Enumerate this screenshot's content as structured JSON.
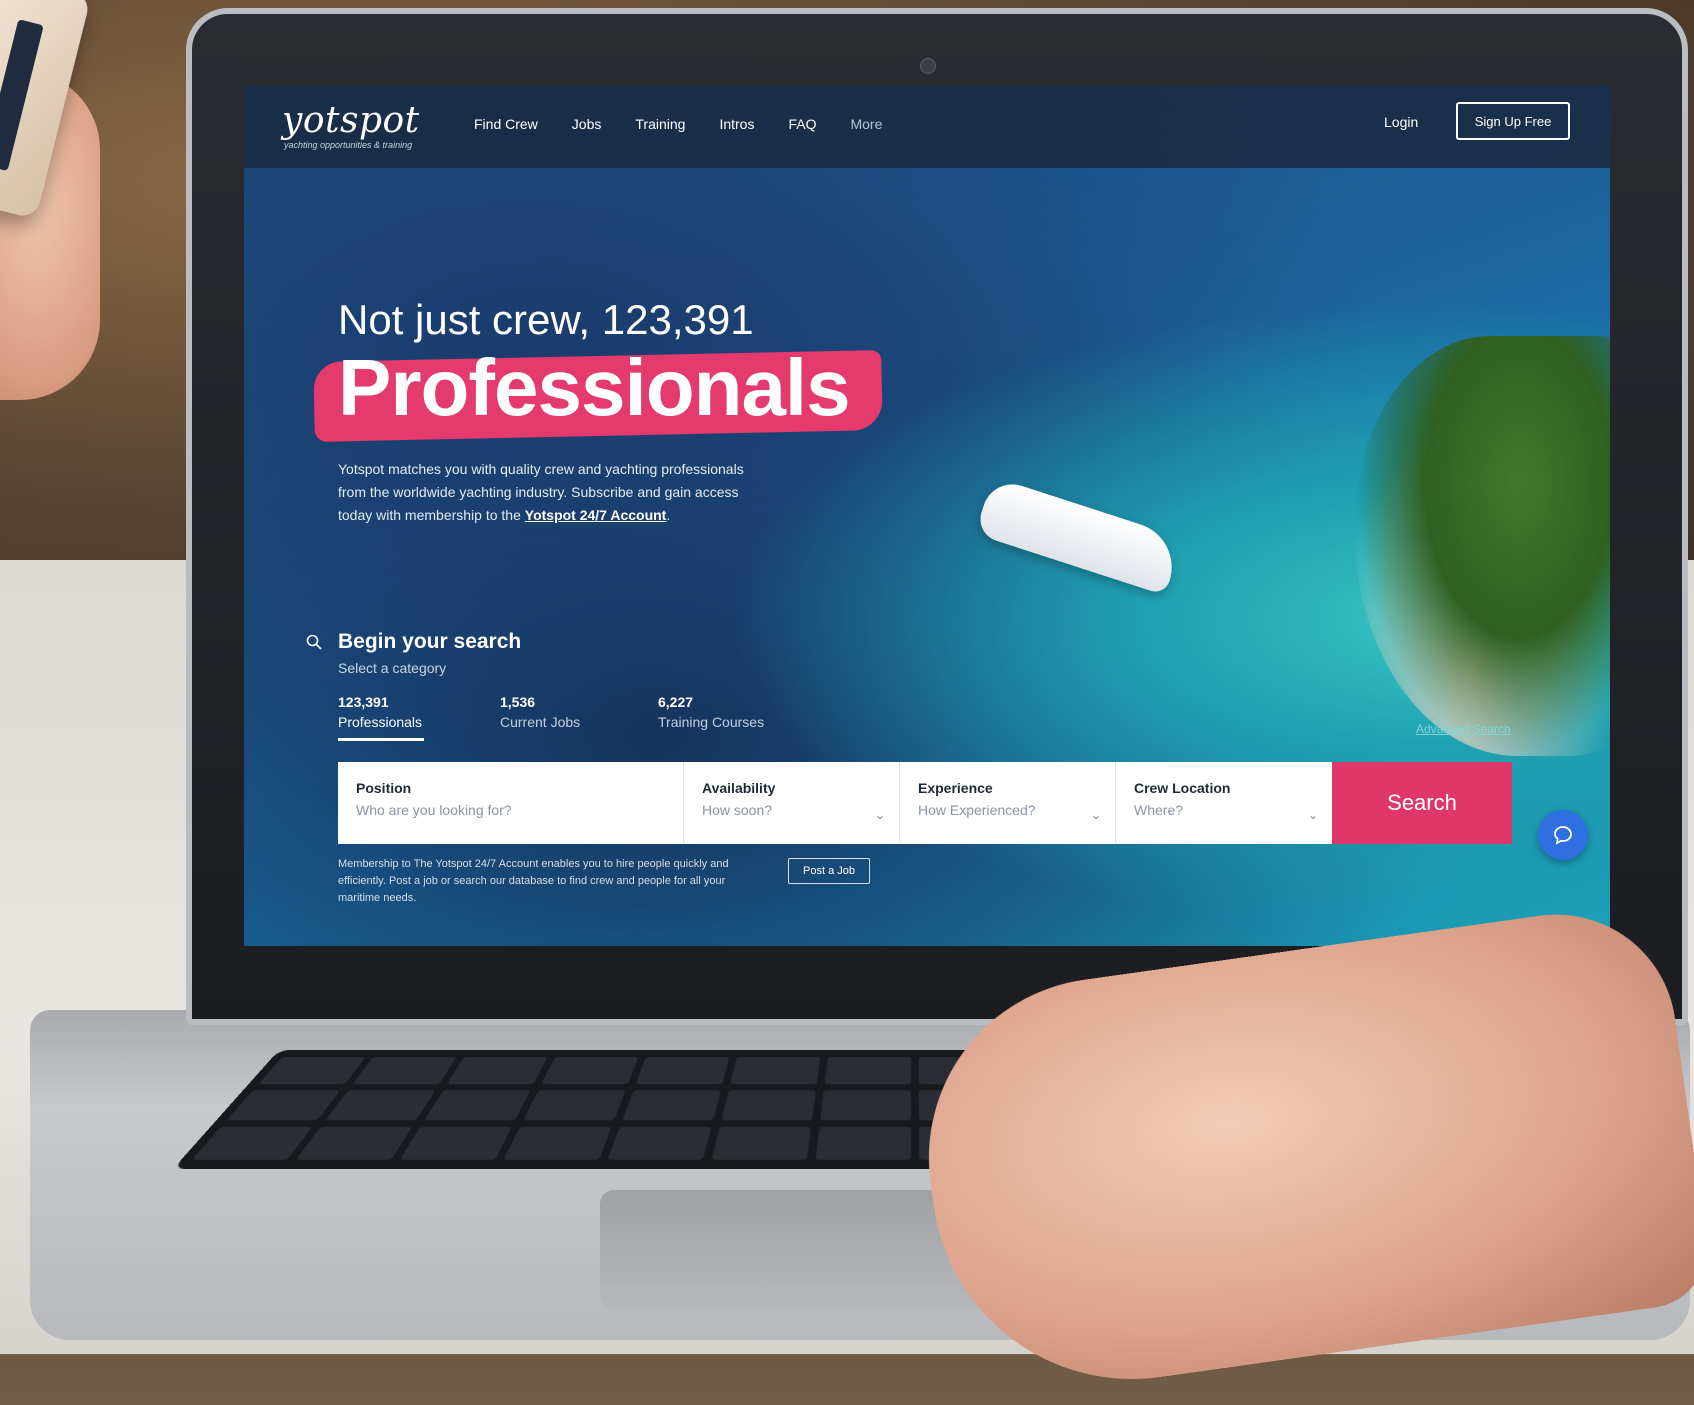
{
  "site": {
    "logo": "yotspot",
    "logo_tagline": "yachting opportunities & training"
  },
  "nav": {
    "links": [
      "Find Crew",
      "Jobs",
      "Training",
      "Intros",
      "FAQ",
      "More"
    ],
    "login": "Login",
    "signup": "Sign Up Free"
  },
  "hero": {
    "line1": "Not just crew, 123,391",
    "line2": "Professionals",
    "description": "Yotspot matches you with quality crew and yachting professionals from the worldwide yachting industry. Subscribe and gain access today with membership to the ",
    "link_text": "Yotspot 24/7 Account",
    "description_end": "."
  },
  "search": {
    "title": "Begin your search",
    "subtitle": "Select a category",
    "categories": [
      {
        "count": "123,391",
        "label": "Professionals"
      },
      {
        "count": "1,536",
        "label": "Current Jobs"
      },
      {
        "count": "6,227",
        "label": "Training Courses"
      }
    ],
    "advanced_link": "Advanced Search",
    "fields": [
      {
        "label": "Position",
        "placeholder": "Who are you looking for?"
      },
      {
        "label": "Availability",
        "placeholder": "How soon?"
      },
      {
        "label": "Experience",
        "placeholder": "How Experienced?"
      },
      {
        "label": "Crew Location",
        "placeholder": "Where?"
      }
    ],
    "button": "Search"
  },
  "footer_note": {
    "text": "Membership to The Yotspot 24/7 Account enables you to hire people quickly and efficiently. Post a job or search our database to find crew and people for all your maritime needs.",
    "post_job": "Post a Job"
  },
  "colors": {
    "accent": "#e0376b",
    "nav_bg": "#1a2b44",
    "chat": "#2f6fe0"
  }
}
